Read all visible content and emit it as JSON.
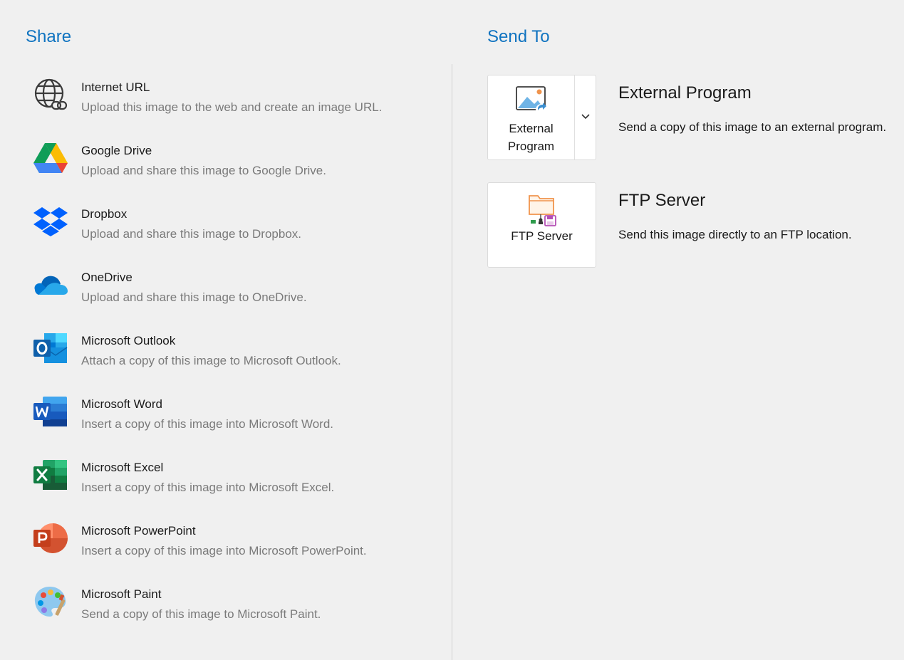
{
  "share": {
    "title": "Share",
    "items": [
      {
        "name": "Internet URL",
        "desc": "Upload this image to the web and create an image URL.",
        "icon": "globe-link-icon"
      },
      {
        "name": "Google Drive",
        "desc": "Upload and share this image to Google Drive.",
        "icon": "google-drive-icon"
      },
      {
        "name": "Dropbox",
        "desc": "Upload and share this image to Dropbox.",
        "icon": "dropbox-icon"
      },
      {
        "name": "OneDrive",
        "desc": "Upload and share this image to OneDrive.",
        "icon": "onedrive-icon"
      },
      {
        "name": "Microsoft Outlook",
        "desc": "Attach a copy of this image to Microsoft Outlook.",
        "icon": "outlook-icon"
      },
      {
        "name": "Microsoft Word",
        "desc": "Insert a copy of this image into Microsoft Word.",
        "icon": "word-icon"
      },
      {
        "name": "Microsoft Excel",
        "desc": "Insert a copy of this image into Microsoft Excel.",
        "icon": "excel-icon"
      },
      {
        "name": "Microsoft PowerPoint",
        "desc": "Insert a copy of this image into Microsoft PowerPoint.",
        "icon": "powerpoint-icon"
      },
      {
        "name": "Microsoft Paint",
        "desc": "Send a copy of this image to Microsoft Paint.",
        "icon": "paint-palette-icon"
      }
    ]
  },
  "send_to": {
    "title": "Send To",
    "external": {
      "button_line1": "External",
      "button_line2": "Program",
      "title": "External Program",
      "desc": "Send a copy of this image to an external program.",
      "icon": "external-program-icon"
    },
    "ftp": {
      "button_label": "FTP Server",
      "title": "FTP Server",
      "desc": "Send this image directly to an FTP location.",
      "icon": "ftp-server-icon"
    }
  },
  "colors": {
    "accent": "#0f73c0",
    "background": "#f0f0f0",
    "muted_text": "#7a7a7a"
  }
}
